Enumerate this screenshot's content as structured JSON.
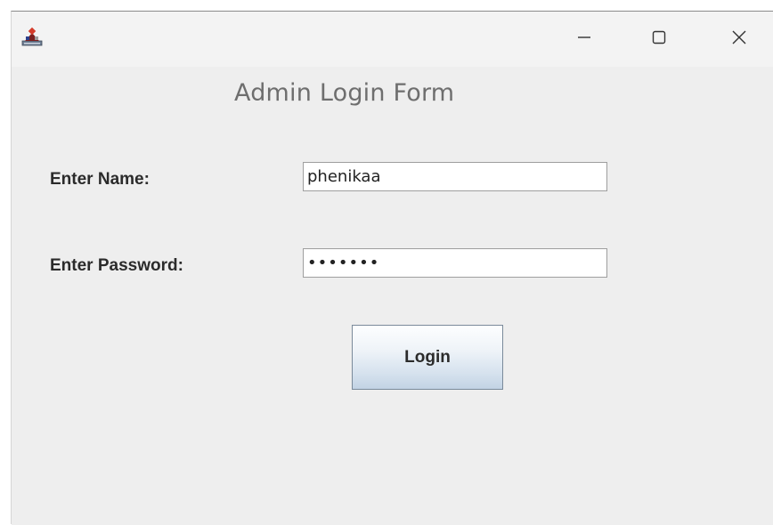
{
  "window": {
    "icon": "java-app-icon",
    "controls": {
      "minimize_icon": "minimize-icon",
      "maximize_icon": "maximize-icon",
      "close_icon": "close-icon"
    }
  },
  "form": {
    "title": "Admin Login Form",
    "name_label": "Enter Name:",
    "name_value": "phenikaa",
    "password_label": "Enter Password:",
    "password_value": "•••••••",
    "login_label": "Login"
  },
  "colors": {
    "window_background": "#eeeeee",
    "title_text": "#6e6e6e",
    "button_gradient_bottom": "#c2d3e4"
  }
}
